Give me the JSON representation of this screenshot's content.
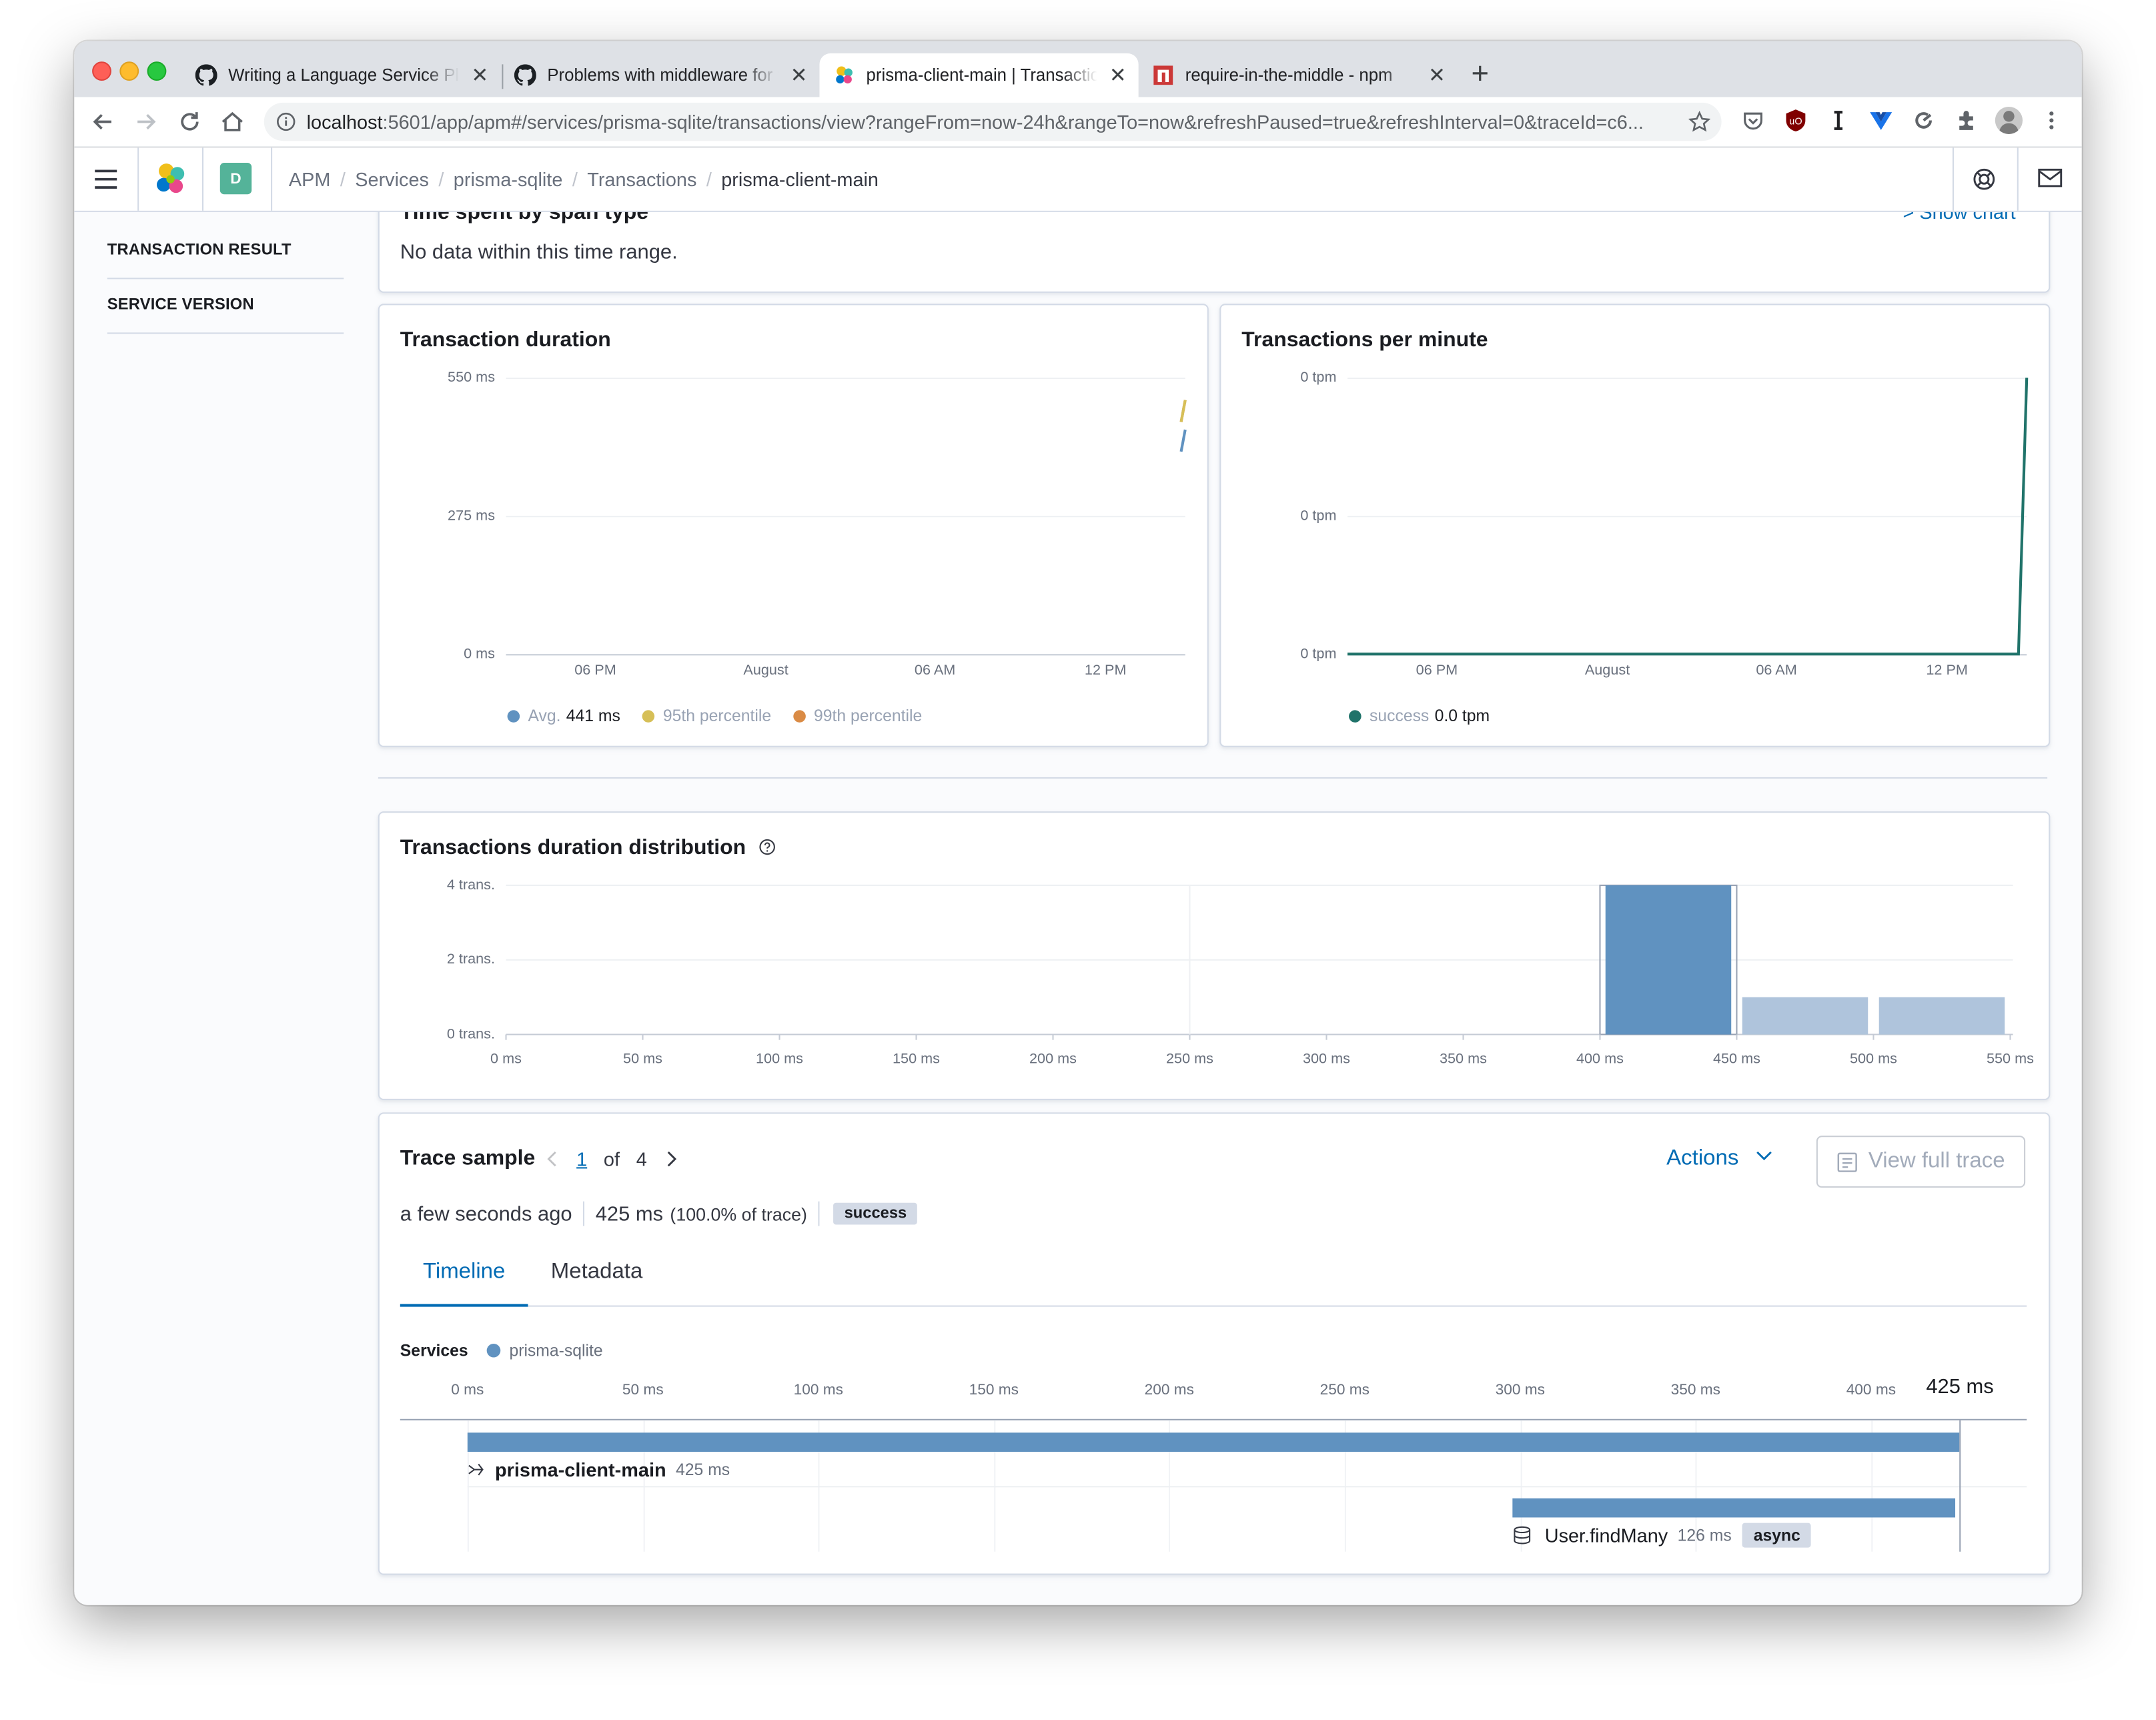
{
  "browser": {
    "tabs": [
      {
        "title": "Writing a Language Service Plugin",
        "icon": "github-icon",
        "active": false
      },
      {
        "title": "Problems with middleware for tracing",
        "icon": "github-icon",
        "active": false
      },
      {
        "title": "prisma-client-main | Transactions",
        "icon": "elastic-icon",
        "active": true
      },
      {
        "title": "require-in-the-middle - npm",
        "icon": "npm-icon",
        "active": false
      }
    ],
    "new_tab": "+",
    "close_glyph": "✕",
    "url_host": "localhost",
    "url_rest": ":5601/app/apm#/services/prisma-sqlite/transactions/view?rangeFrom=now-24h&rangeTo=now&refreshPaused=true&refreshInterval=0&traceId=c6..."
  },
  "kibana": {
    "space_initial": "D",
    "space_color": "#54b399",
    "breadcrumbs": [
      "APM",
      "Services",
      "prisma-sqlite",
      "Transactions"
    ],
    "breadcrumb_current": "prisma-client-main"
  },
  "sidebar": {
    "items": [
      "TRANSACTION RESULT",
      "SERVICE VERSION"
    ]
  },
  "span_type_panel": {
    "title": "Time spent by span type",
    "show_chart": "Show chart",
    "message": "No data within this time range."
  },
  "duration_chart": {
    "title": "Transaction duration",
    "y_ticks": [
      "550 ms",
      "275 ms",
      "0 ms"
    ],
    "x_ticks": [
      "06 PM",
      "August",
      "06 AM",
      "12 PM"
    ],
    "legend": [
      {
        "label": "Avg.",
        "value": "441 ms",
        "color": "#6092c0"
      },
      {
        "label": "95th percentile",
        "value": "",
        "color": "#d6bf57"
      },
      {
        "label": "99th percentile",
        "value": "",
        "color": "#da8b45"
      }
    ]
  },
  "tpm_chart": {
    "title": "Transactions per minute",
    "y_ticks": [
      "0 tpm",
      "0 tpm",
      "0 tpm"
    ],
    "x_ticks": [
      "06 PM",
      "August",
      "06 AM",
      "12 PM"
    ],
    "legend": [
      {
        "label": "success",
        "value": "0.0 tpm",
        "color": "#20736a"
      }
    ]
  },
  "distribution": {
    "title": "Transactions duration distribution",
    "y_ticks": [
      "4 trans.",
      "2 trans.",
      "0 trans."
    ],
    "x_ticks": [
      "0 ms",
      "50 ms",
      "100 ms",
      "150 ms",
      "200 ms",
      "250 ms",
      "300 ms",
      "350 ms",
      "400 ms",
      "450 ms",
      "500 ms",
      "550 ms"
    ]
  },
  "chart_data": [
    {
      "type": "line",
      "title": "Transaction duration",
      "x_ticks": [
        "06 PM",
        "August",
        "06 AM",
        "12 PM"
      ],
      "ylim": [
        0,
        550
      ],
      "ylabel": "ms",
      "series": [
        {
          "name": "Avg.",
          "values": [
            441
          ]
        },
        {
          "name": "95th percentile",
          "values": [
            500
          ]
        },
        {
          "name": "99th percentile",
          "values": [
            500
          ]
        }
      ]
    },
    {
      "type": "line",
      "title": "Transactions per minute",
      "x_ticks": [
        "06 PM",
        "August",
        "06 AM",
        "12 PM"
      ],
      "series": [
        {
          "name": "success",
          "values": [
            0,
            0,
            0,
            0,
            1
          ]
        }
      ]
    },
    {
      "type": "bar",
      "title": "Transactions duration distribution",
      "bins": [
        [
          400,
          450
        ],
        [
          450,
          500
        ],
        [
          500,
          550
        ]
      ],
      "values": [
        4,
        1,
        1
      ],
      "selected_bin": 0,
      "xlim": [
        0,
        550
      ],
      "ylim": [
        0,
        4
      ]
    }
  ],
  "trace": {
    "title": "Trace sample",
    "page": "1",
    "of": "of",
    "total": "4",
    "actions": "Actions",
    "view_full": "View full trace",
    "when": "a few seconds ago",
    "duration": "425 ms",
    "pct": "(100.0% of trace)",
    "result": "success",
    "tabs": [
      "Timeline",
      "Metadata"
    ],
    "services_label": "Services",
    "service_name": "prisma-sqlite",
    "service_color": "#6092c0",
    "timeline_ticks": [
      "0 ms",
      "50 ms",
      "100 ms",
      "150 ms",
      "200 ms",
      "250 ms",
      "300 ms",
      "350 ms",
      "400 ms"
    ],
    "timeline_total": "425 ms",
    "spans": [
      {
        "name": "prisma-client-main",
        "duration": "425 ms",
        "start_ms": 0,
        "length_ms": 425,
        "icon": "transaction-icon"
      },
      {
        "name": "User.findMany",
        "duration": "126 ms",
        "start_ms": 298,
        "length_ms": 126,
        "icon": "database-icon",
        "badge": "async"
      }
    ]
  }
}
